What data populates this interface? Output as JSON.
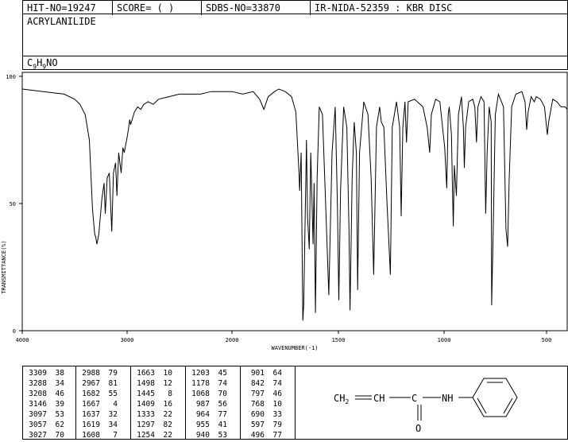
{
  "header": {
    "hit_no": "HIT-NO=19247",
    "score": "SCORE=  (   )",
    "sdbs_no": "SDBS-NO=33870",
    "ir": "IR-NIDA-52359 : KBR DISC"
  },
  "compound_name": "ACRYLANILIDE",
  "formula": {
    "c": "C",
    "c_n": "9",
    "h": "H",
    "h_n": "9",
    "rest": "NO"
  },
  "chart_data": {
    "type": "line",
    "xlabel": "WAVENUMBER(-1)",
    "ylabel": "TRANSMITTANCE(%)",
    "xlim": [
      4000,
      400
    ],
    "ylim": [
      0,
      100
    ],
    "xticks": [
      "4000",
      "3000",
      "2000",
      "1500",
      "1000",
      "500"
    ],
    "yticks": [
      "0",
      "50",
      "100"
    ],
    "grid": false,
    "series": [
      {
        "points": [
          [
            4000,
            95
          ],
          [
            3800,
            94
          ],
          [
            3600,
            93
          ],
          [
            3500,
            91
          ],
          [
            3450,
            89
          ],
          [
            3400,
            85
          ],
          [
            3360,
            75
          ],
          [
            3330,
            48
          ],
          [
            3309,
            38
          ],
          [
            3300,
            37
          ],
          [
            3288,
            34
          ],
          [
            3270,
            38
          ],
          [
            3240,
            52
          ],
          [
            3220,
            58
          ],
          [
            3208,
            46
          ],
          [
            3190,
            60
          ],
          [
            3170,
            62
          ],
          [
            3146,
            39
          ],
          [
            3130,
            62
          ],
          [
            3110,
            66
          ],
          [
            3097,
            53
          ],
          [
            3080,
            70
          ],
          [
            3057,
            62
          ],
          [
            3040,
            72
          ],
          [
            3027,
            70
          ],
          [
            3000,
            76
          ],
          [
            2988,
            79
          ],
          [
            2975,
            83
          ],
          [
            2967,
            81
          ],
          [
            2930,
            86
          ],
          [
            2900,
            88
          ],
          [
            2870,
            87
          ],
          [
            2840,
            89
          ],
          [
            2800,
            90
          ],
          [
            2750,
            89
          ],
          [
            2700,
            91
          ],
          [
            2600,
            92
          ],
          [
            2500,
            93
          ],
          [
            2400,
            93
          ],
          [
            2300,
            93
          ],
          [
            2200,
            94
          ],
          [
            2100,
            94
          ],
          [
            2050,
            94
          ],
          [
            2000,
            94
          ],
          [
            1950,
            93
          ],
          [
            1900,
            94
          ],
          [
            1870,
            91
          ],
          [
            1850,
            87
          ],
          [
            1830,
            92
          ],
          [
            1800,
            94
          ],
          [
            1780,
            95
          ],
          [
            1750,
            94
          ],
          [
            1720,
            92
          ],
          [
            1700,
            86
          ],
          [
            1685,
            62
          ],
          [
            1682,
            55
          ],
          [
            1675,
            70
          ],
          [
            1667,
            4
          ],
          [
            1663,
            10
          ],
          [
            1660,
            25
          ],
          [
            1650,
            75
          ],
          [
            1645,
            45
          ],
          [
            1637,
            32
          ],
          [
            1630,
            70
          ],
          [
            1619,
            34
          ],
          [
            1614,
            58
          ],
          [
            1608,
            7
          ],
          [
            1600,
            60
          ],
          [
            1590,
            88
          ],
          [
            1575,
            85
          ],
          [
            1560,
            50
          ],
          [
            1545,
            14
          ],
          [
            1530,
            70
          ],
          [
            1515,
            88
          ],
          [
            1505,
            50
          ],
          [
            1498,
            12
          ],
          [
            1490,
            55
          ],
          [
            1475,
            88
          ],
          [
            1460,
            80
          ],
          [
            1450,
            40
          ],
          [
            1445,
            8
          ],
          [
            1435,
            60
          ],
          [
            1425,
            82
          ],
          [
            1415,
            70
          ],
          [
            1409,
            16
          ],
          [
            1400,
            70
          ],
          [
            1380,
            90
          ],
          [
            1360,
            85
          ],
          [
            1345,
            60
          ],
          [
            1333,
            22
          ],
          [
            1320,
            80
          ],
          [
            1305,
            88
          ],
          [
            1297,
            82
          ],
          [
            1285,
            80
          ],
          [
            1270,
            50
          ],
          [
            1254,
            22
          ],
          [
            1245,
            80
          ],
          [
            1225,
            90
          ],
          [
            1210,
            80
          ],
          [
            1203,
            45
          ],
          [
            1195,
            80
          ],
          [
            1185,
            90
          ],
          [
            1178,
            74
          ],
          [
            1170,
            90
          ],
          [
            1140,
            91
          ],
          [
            1100,
            88
          ],
          [
            1080,
            80
          ],
          [
            1068,
            70
          ],
          [
            1060,
            85
          ],
          [
            1040,
            91
          ],
          [
            1020,
            90
          ],
          [
            997,
            72
          ],
          [
            987,
            56
          ],
          [
            980,
            85
          ],
          [
            975,
            88
          ],
          [
            964,
            77
          ],
          [
            960,
            60
          ],
          [
            955,
            41
          ],
          [
            950,
            65
          ],
          [
            940,
            53
          ],
          [
            930,
            85
          ],
          [
            915,
            92
          ],
          [
            906,
            80
          ],
          [
            901,
            64
          ],
          [
            895,
            80
          ],
          [
            880,
            90
          ],
          [
            860,
            91
          ],
          [
            850,
            88
          ],
          [
            842,
            74
          ],
          [
            835,
            88
          ],
          [
            820,
            92
          ],
          [
            805,
            90
          ],
          [
            797,
            46
          ],
          [
            790,
            70
          ],
          [
            780,
            88
          ],
          [
            770,
            82
          ],
          [
            768,
            10
          ],
          [
            760,
            40
          ],
          [
            750,
            85
          ],
          [
            735,
            93
          ],
          [
            710,
            88
          ],
          [
            698,
            40
          ],
          [
            690,
            33
          ],
          [
            682,
            60
          ],
          [
            670,
            88
          ],
          [
            650,
            93
          ],
          [
            620,
            94
          ],
          [
            605,
            90
          ],
          [
            597,
            79
          ],
          [
            590,
            86
          ],
          [
            575,
            92
          ],
          [
            560,
            90
          ],
          [
            550,
            92
          ],
          [
            530,
            91
          ],
          [
            510,
            88
          ],
          [
            500,
            80
          ],
          [
            496,
            77
          ],
          [
            490,
            82
          ],
          [
            470,
            91
          ],
          [
            450,
            90
          ],
          [
            430,
            88
          ],
          [
            410,
            88
          ],
          [
            400,
            87
          ]
        ]
      }
    ]
  },
  "peaks": {
    "col1": [
      [
        "3309",
        "38"
      ],
      [
        "3288",
        "34"
      ],
      [
        "3208",
        "46"
      ],
      [
        "3146",
        "39"
      ],
      [
        "3097",
        "53"
      ],
      [
        "3057",
        "62"
      ],
      [
        "3027",
        "70"
      ]
    ],
    "col2": [
      [
        "2988",
        "79"
      ],
      [
        "2967",
        "81"
      ],
      [
        "1682",
        "55"
      ],
      [
        "1667",
        "4"
      ],
      [
        "1637",
        "32"
      ],
      [
        "1619",
        "34"
      ],
      [
        "1608",
        "7"
      ]
    ],
    "col3": [
      [
        "1663",
        "10"
      ],
      [
        "1498",
        "12"
      ],
      [
        "1445",
        "8"
      ],
      [
        "1409",
        "16"
      ],
      [
        "1333",
        "22"
      ],
      [
        "1297",
        "82"
      ],
      [
        "1254",
        "22"
      ]
    ],
    "col4": [
      [
        "1203",
        "45"
      ],
      [
        "1178",
        "74"
      ],
      [
        "1068",
        "70"
      ],
      [
        "987",
        "56"
      ],
      [
        "964",
        "77"
      ],
      [
        "955",
        "41"
      ],
      [
        "940",
        "53"
      ]
    ],
    "col5": [
      [
        "901",
        "64"
      ],
      [
        "842",
        "74"
      ],
      [
        "797",
        "46"
      ],
      [
        "768",
        "10"
      ],
      [
        "690",
        "33"
      ],
      [
        "597",
        "79"
      ],
      [
        "496",
        "77"
      ]
    ]
  },
  "structure": {
    "ch2": "CH",
    "ch2_sub": "2",
    "ch": "CH",
    "c": "C",
    "nh": "NH",
    "o": "O"
  }
}
